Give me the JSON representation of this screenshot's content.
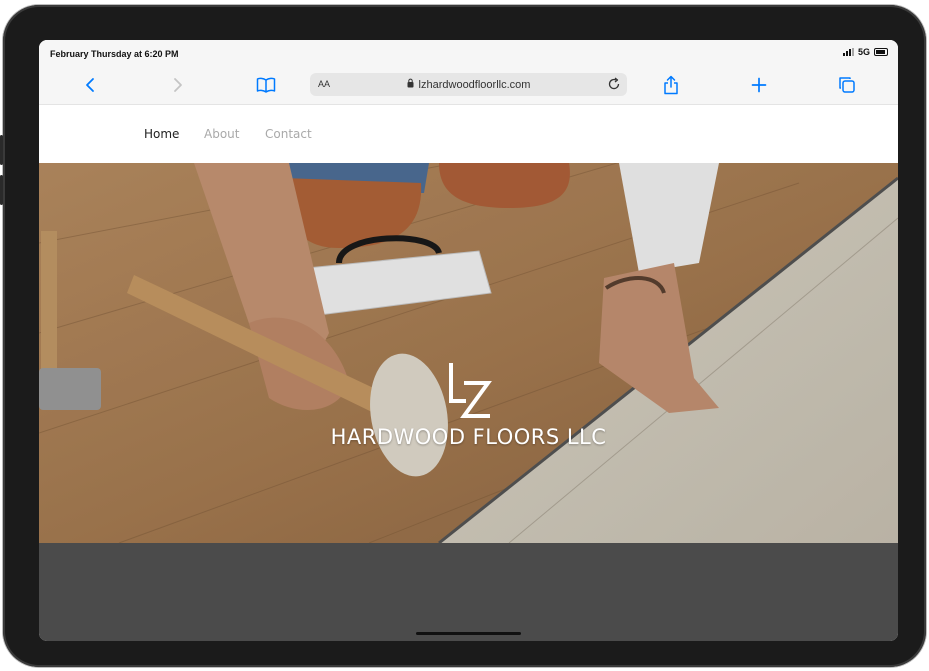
{
  "status": {
    "time": "February Thursday at 6:20 PM",
    "network": "5G"
  },
  "browser": {
    "reader_label": "AA",
    "url": "lzhardwoodfloorllc.com",
    "icons": [
      "back-icon",
      "forward-icon",
      "bookmarks-icon",
      "lock-icon",
      "reload-icon",
      "share-icon",
      "new-tab-icon",
      "tabs-icon"
    ]
  },
  "nav": {
    "home": "Home",
    "about": "About",
    "contact": "Contact"
  },
  "hero": {
    "logo_mark": "LZ",
    "title": "HARDWOOD FLOORS LLC"
  },
  "colors": {
    "accent": "#007aff",
    "nav_active": "#222222",
    "nav_inactive": "#a9a9a9",
    "footer": "#4b4b4b"
  }
}
